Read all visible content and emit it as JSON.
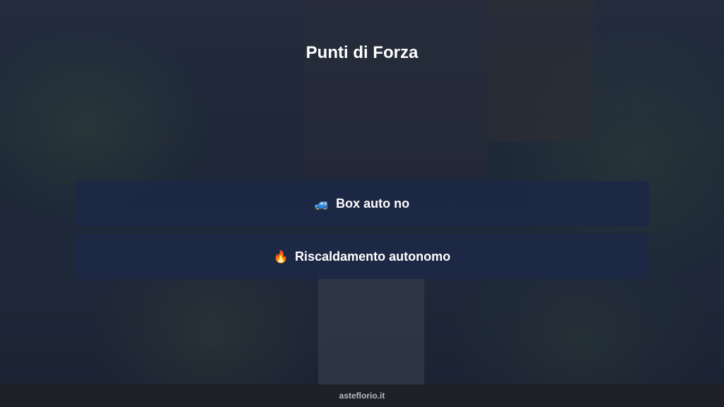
{
  "slide": {
    "title": "Punti di Forza",
    "features": [
      {
        "icon": "car-icon",
        "glyph": "🚙",
        "label": "Box auto no"
      },
      {
        "icon": "fire-icon",
        "glyph": "🔥",
        "label": "Riscaldamento autonomo"
      }
    ]
  },
  "footer": {
    "brand": "asteflorio.it"
  },
  "colors": {
    "card_background": "#1c2846",
    "page_background": "#1b2536",
    "text": "#ffffff",
    "footer_text": "#b8bcc4"
  }
}
